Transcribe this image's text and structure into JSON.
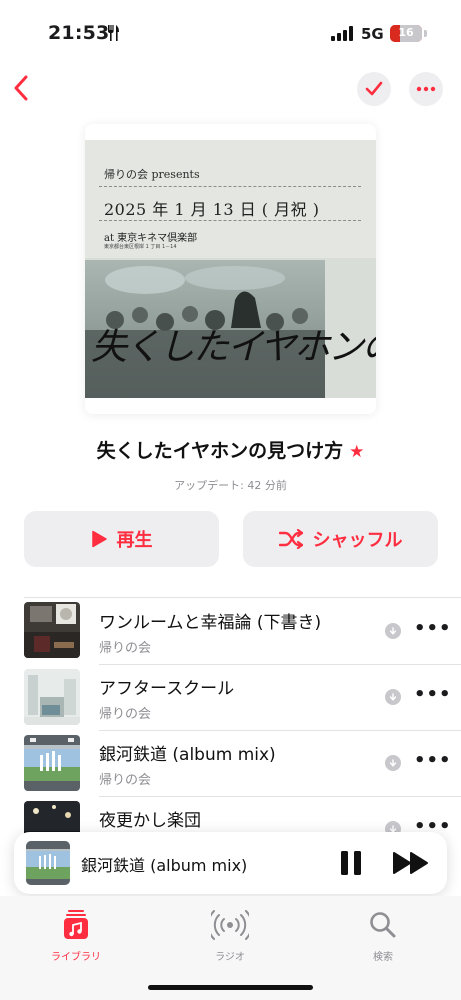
{
  "status_bar": {
    "time": "21:53",
    "network": "5G",
    "battery_level": "16",
    "icons": [
      "fork-knife-icon",
      "signal-icon",
      "battery-icon"
    ]
  },
  "nav": {
    "back_icon": "chevron-left-icon",
    "check_icon": "checkmark-icon",
    "more_icon": "ellipsis-icon"
  },
  "artwork": {
    "presenter": "帰りの会 presents",
    "date": "2025 年 1 月 13 日 ( 月祝 )",
    "venue": "at 東京キネマ倶楽部",
    "address": "東京都台東区根岸 1 丁目 1－14",
    "title": "失くしたイヤホンの見つけ方"
  },
  "playlist": {
    "title": "失くしたイヤホンの見つけ方",
    "favorite_icon": "star-icon",
    "updated": "アップデート: 42 分前"
  },
  "actions": {
    "play_label": "再生",
    "shuffle_label": "シャッフル"
  },
  "tracks": [
    {
      "title": "ワンルームと幸福論 (下書き)",
      "artist": "帰りの会"
    },
    {
      "title": "アフタースクール",
      "artist": "帰りの会"
    },
    {
      "title": "銀河鉄道 (album mix)",
      "artist": "帰りの会"
    },
    {
      "title": "夜更かし楽団",
      "artist": ""
    }
  ],
  "mini_player": {
    "title": "銀河鉄道 (album mix)"
  },
  "tab_bar": {
    "library": "ライブラリ",
    "radio": "ラジオ",
    "search": "検索"
  },
  "colors": {
    "accent": "#ff2d40",
    "secondary_text": "#8e8e93",
    "button_bg": "#eeeef0"
  }
}
